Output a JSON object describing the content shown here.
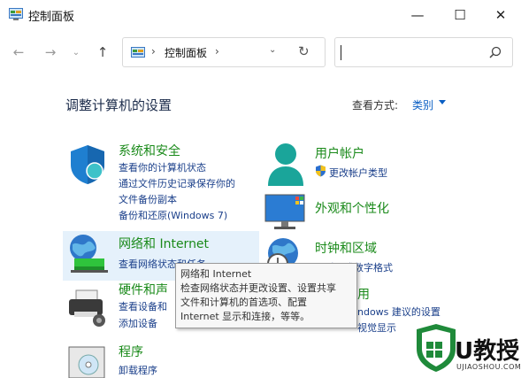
{
  "window": {
    "title": "控制面板",
    "minimize_glyph": "—",
    "maximize_glyph": "☐",
    "close_glyph": "✕"
  },
  "nav": {
    "back_glyph": "←",
    "forward_glyph": "→",
    "recent_glyph": "⌄",
    "up_glyph": "↑"
  },
  "address": {
    "separator": "›",
    "path": "控制面板",
    "dropdown_glyph": "⌄",
    "refresh_glyph": "↻"
  },
  "search": {
    "placeholder": ""
  },
  "page_title": "调整计算机的设置",
  "view_by": {
    "label": "查看方式:",
    "value": "类别"
  },
  "left_categories": [
    {
      "title": "系统和安全",
      "icon": "shield-icon",
      "links": [
        "查看你的计算机状态",
        "通过文件历史记录保存你的",
        "文件备份副本",
        "备份和还原(Windows 7)"
      ]
    },
    {
      "title": "网络和 Internet",
      "icon": "network-globe-icon",
      "links": [
        "查看网络状态和任务"
      ]
    },
    {
      "title": "硬件和声",
      "icon": "printer-icon",
      "links": [
        "查看设备和",
        "添加设备"
      ]
    },
    {
      "title": "程序",
      "icon": "programs-icon",
      "links": [
        "卸载程序"
      ]
    }
  ],
  "right_categories": [
    {
      "title": "用户帐户",
      "icon": "user-icon",
      "links": [
        "更改帐户类型"
      ],
      "link_icon": "uac-shield-icon"
    },
    {
      "title": "外观和个性化",
      "icon": "monitor-icon",
      "links": []
    },
    {
      "title": "时钟和区域",
      "icon": "clock-globe-icon",
      "links": [
        "、时间或数字格式"
      ]
    },
    {
      "title": "用",
      "icon": "ease-of-access-icon",
      "links": [
        "ndows 建议的设置",
        "视觉显示"
      ]
    }
  ],
  "tooltip": {
    "lines": [
      "网络和 Internet",
      "检查网络状态并更改设置、设置共享",
      "文件和计算机的首选项、配置",
      "Internet 显示和连接，等等。"
    ]
  },
  "watermark": {
    "text": "U教授",
    "sub": "UJIAOSHOU.COM"
  },
  "colors": {
    "category_green": "#1a8a1a",
    "link_blue": "#1a3f8a",
    "accent_blue": "#0a5fc4",
    "hover_bg": "#e5f1fb"
  }
}
